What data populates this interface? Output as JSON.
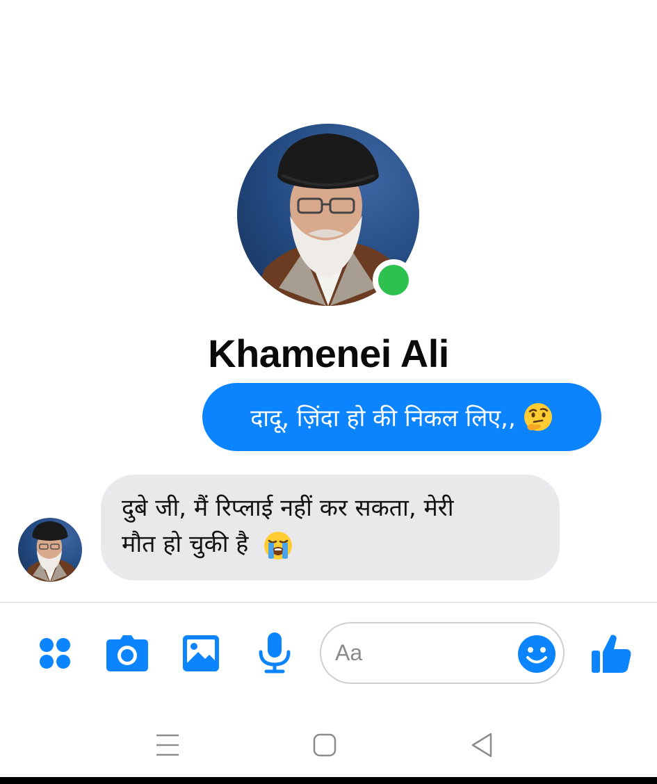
{
  "contact": {
    "name": "Khamenei Ali",
    "status": "online"
  },
  "messages": [
    {
      "direction": "outgoing",
      "text": "दादू, ज़िंदा हो की निकल लिए,,",
      "emoji": "thinking-face-emoji"
    },
    {
      "direction": "incoming",
      "lines": [
        "दुबे जी, मैं रिप्लाई नहीं कर सकता, मेरी",
        "मौत हो चुकी है"
      ],
      "emoji": "loudly-crying-face-emoji"
    }
  ],
  "composer": {
    "placeholder": "Aa",
    "icons": [
      "more-apps-icon",
      "camera-icon",
      "gallery-icon",
      "microphone-icon",
      "emoji-icon",
      "thumbs-up-icon"
    ]
  },
  "navigation": {
    "icons": [
      "recent-apps-icon",
      "home-icon",
      "back-icon"
    ]
  },
  "colors": {
    "accent": "#0b84fe",
    "incoming_bubble": "#e9e9eb",
    "online": "#2fc150",
    "text": "#0a0a0a"
  }
}
